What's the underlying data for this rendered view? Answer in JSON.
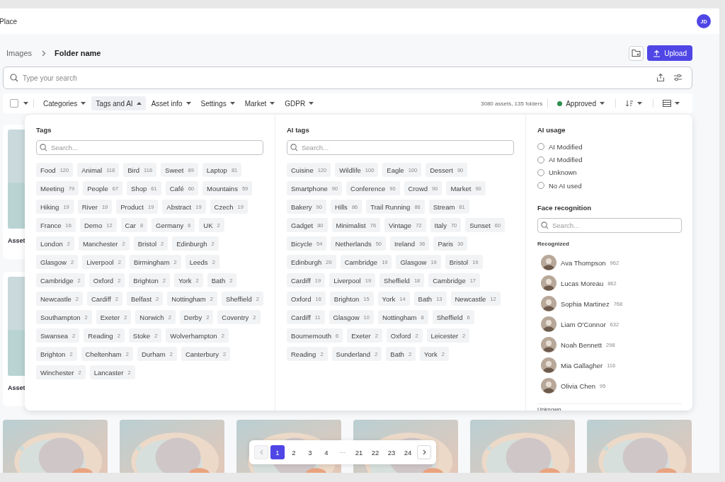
{
  "app": {
    "title": "Place",
    "avatar": "JD"
  },
  "breadcrumb": [
    "Images",
    "Folder name"
  ],
  "actions": {
    "upload": "Upload"
  },
  "search": {
    "placeholder": "Type your search"
  },
  "filters": [
    {
      "label": "Categories",
      "selected": false
    },
    {
      "label": "Tags and AI",
      "selected": true
    },
    {
      "label": "Asset info",
      "selected": false
    },
    {
      "label": "Settings",
      "selected": false
    },
    {
      "label": "Market",
      "selected": false
    },
    {
      "label": "GDPR",
      "selected": false
    }
  ],
  "select_all": {
    "checked": false
  },
  "summary": "3080 assets, 135 folders",
  "status": {
    "label": "Approved",
    "color": "#2f8f4e"
  },
  "assets": [
    {
      "label": "Asset"
    },
    {
      "label": "Asset"
    }
  ],
  "dropdown": {
    "tags": {
      "title": "Tags",
      "placeholder": "Search...",
      "items": [
        {
          "name": "Food",
          "count": "120"
        },
        {
          "name": "Animal",
          "count": "118"
        },
        {
          "name": "Bird",
          "count": "116"
        },
        {
          "name": "Sweet",
          "count": "89"
        },
        {
          "name": "Laptop",
          "count": "81"
        },
        {
          "name": "Meeting",
          "count": "79"
        },
        {
          "name": "People",
          "count": "67"
        },
        {
          "name": "Shop",
          "count": "61"
        },
        {
          "name": "Café",
          "count": "60"
        },
        {
          "name": "Mountains",
          "count": "59"
        },
        {
          "name": "Hiking",
          "count": "19"
        },
        {
          "name": "River",
          "count": "19"
        },
        {
          "name": "Product",
          "count": "19"
        },
        {
          "name": "Abstract",
          "count": "19"
        },
        {
          "name": "Czech",
          "count": "19"
        },
        {
          "name": "France",
          "count": "16"
        },
        {
          "name": "Demo",
          "count": "12"
        },
        {
          "name": "Car",
          "count": "8"
        },
        {
          "name": "Germany",
          "count": "6"
        },
        {
          "name": "UK",
          "count": "2"
        },
        {
          "name": "London",
          "count": "2"
        },
        {
          "name": "Manchester",
          "count": "2"
        },
        {
          "name": "Bristol",
          "count": "2"
        },
        {
          "name": "Edinburgh",
          "count": "2"
        },
        {
          "name": "Glasgow",
          "count": "2"
        },
        {
          "name": "Liverpool",
          "count": "2"
        },
        {
          "name": "Birmingham",
          "count": "2"
        },
        {
          "name": "Leeds",
          "count": "2"
        },
        {
          "name": "Cambridge",
          "count": "2"
        },
        {
          "name": "Oxford",
          "count": "2"
        },
        {
          "name": "Brighton",
          "count": "2"
        },
        {
          "name": "York",
          "count": "2"
        },
        {
          "name": "Bath",
          "count": "2"
        },
        {
          "name": "Newcastle",
          "count": "2"
        },
        {
          "name": "Cardiff",
          "count": "2"
        },
        {
          "name": "Belfast",
          "count": "2"
        },
        {
          "name": "Nottingham",
          "count": "2"
        },
        {
          "name": "Sheffield",
          "count": "2"
        },
        {
          "name": "Southampton",
          "count": "2"
        },
        {
          "name": "Exeter",
          "count": "2"
        },
        {
          "name": "Norwich",
          "count": "2"
        },
        {
          "name": "Derby",
          "count": "2"
        },
        {
          "name": "Coventry",
          "count": "2"
        },
        {
          "name": "Swansea",
          "count": "2"
        },
        {
          "name": "Reading",
          "count": "2"
        },
        {
          "name": "Stoke",
          "count": "2"
        },
        {
          "name": "Wolverhampton",
          "count": "2"
        },
        {
          "name": "Brighton",
          "count": "2"
        },
        {
          "name": "Cheltenham",
          "count": "2"
        },
        {
          "name": "Durham",
          "count": "2"
        },
        {
          "name": "Canterbury",
          "count": "2"
        },
        {
          "name": "Winchester",
          "count": "2"
        },
        {
          "name": "Lancaster",
          "count": "2"
        }
      ]
    },
    "ai_tags": {
      "title": "AI tags",
      "placeholder": "Search...",
      "items": [
        {
          "name": "Cuisine",
          "count": "120"
        },
        {
          "name": "Wildlife",
          "count": "100"
        },
        {
          "name": "Eagle",
          "count": "100"
        },
        {
          "name": "Dessert",
          "count": "90"
        },
        {
          "name": "Smartphone",
          "count": "90"
        },
        {
          "name": "Conference",
          "count": "90"
        },
        {
          "name": "Crowd",
          "count": "90"
        },
        {
          "name": "Market",
          "count": "90"
        },
        {
          "name": "Bakery",
          "count": "90"
        },
        {
          "name": "Hills",
          "count": "86"
        },
        {
          "name": "Trail Running",
          "count": "86"
        },
        {
          "name": "Stream",
          "count": "81"
        },
        {
          "name": "Gadget",
          "count": "80"
        },
        {
          "name": "Minimalist",
          "count": "76"
        },
        {
          "name": "Vintage",
          "count": "72"
        },
        {
          "name": "Italy",
          "count": "70"
        },
        {
          "name": "Sunset",
          "count": "60"
        },
        {
          "name": "Bicycle",
          "count": "54"
        },
        {
          "name": "Netherlands",
          "count": "50"
        },
        {
          "name": "Ireland",
          "count": "36"
        },
        {
          "name": "Paris",
          "count": "30"
        },
        {
          "name": "Edinburgh",
          "count": "20"
        },
        {
          "name": "Cambridge",
          "count": "19"
        },
        {
          "name": "Glasgow",
          "count": "19"
        },
        {
          "name": "Bristol",
          "count": "19"
        },
        {
          "name": "Cardiff",
          "count": "19"
        },
        {
          "name": "Liverpool",
          "count": "19"
        },
        {
          "name": "Sheffield",
          "count": "18"
        },
        {
          "name": "Cambridge",
          "count": "17"
        },
        {
          "name": "Oxford",
          "count": "16"
        },
        {
          "name": "Brighton",
          "count": "15"
        },
        {
          "name": "York",
          "count": "14"
        },
        {
          "name": "Bath",
          "count": "13"
        },
        {
          "name": "Newcastle",
          "count": "12"
        },
        {
          "name": "Cardiff",
          "count": "11"
        },
        {
          "name": "Glasgow",
          "count": "10"
        },
        {
          "name": "Nottingham",
          "count": "8"
        },
        {
          "name": "Sheffield",
          "count": "6"
        },
        {
          "name": "Bournemouth",
          "count": "6"
        },
        {
          "name": "Exeter",
          "count": "2"
        },
        {
          "name": "Oxford",
          "count": "2"
        },
        {
          "name": "Leicester",
          "count": "2"
        },
        {
          "name": "Reading",
          "count": "2"
        },
        {
          "name": "Sunderland",
          "count": "2"
        },
        {
          "name": "Bath",
          "count": "2"
        },
        {
          "name": "York",
          "count": "2"
        }
      ]
    },
    "ai_usage": {
      "title": "AI usage",
      "options": [
        {
          "label": "AI Modified",
          "checked": false
        },
        {
          "label": "AI Modified",
          "checked": false
        },
        {
          "label": "Unknown",
          "checked": false
        },
        {
          "label": "No AI used",
          "checked": false
        }
      ]
    },
    "faces": {
      "title": "Face recognition",
      "placeholder": "Search...",
      "recognized_title": "Recognized",
      "people": [
        {
          "name": "Ava Thompson",
          "count": "962"
        },
        {
          "name": "Lucas Moreau",
          "count": "862"
        },
        {
          "name": "Sophia Martinez",
          "count": "768"
        },
        {
          "name": "Liam O'Connor",
          "count": "632"
        },
        {
          "name": "Noah Bennett",
          "count": "298"
        },
        {
          "name": "Mia Gallagher",
          "count": "116"
        },
        {
          "name": "Olivia Chen",
          "count": "95"
        }
      ],
      "unknown_title": "Unknown"
    }
  },
  "pagination": {
    "pages": [
      {
        "kind": "page",
        "label": "1",
        "selected": true
      },
      {
        "kind": "page",
        "label": "2",
        "selected": false
      },
      {
        "kind": "page",
        "label": "3",
        "selected": false
      },
      {
        "kind": "page",
        "label": "4",
        "selected": false
      },
      {
        "kind": "ellipsis",
        "label": "···"
      },
      {
        "kind": "page",
        "label": "21",
        "selected": false
      },
      {
        "kind": "page",
        "label": "22",
        "selected": false
      },
      {
        "kind": "page",
        "label": "23",
        "selected": false
      },
      {
        "kind": "page",
        "label": "24",
        "selected": false
      }
    ]
  }
}
